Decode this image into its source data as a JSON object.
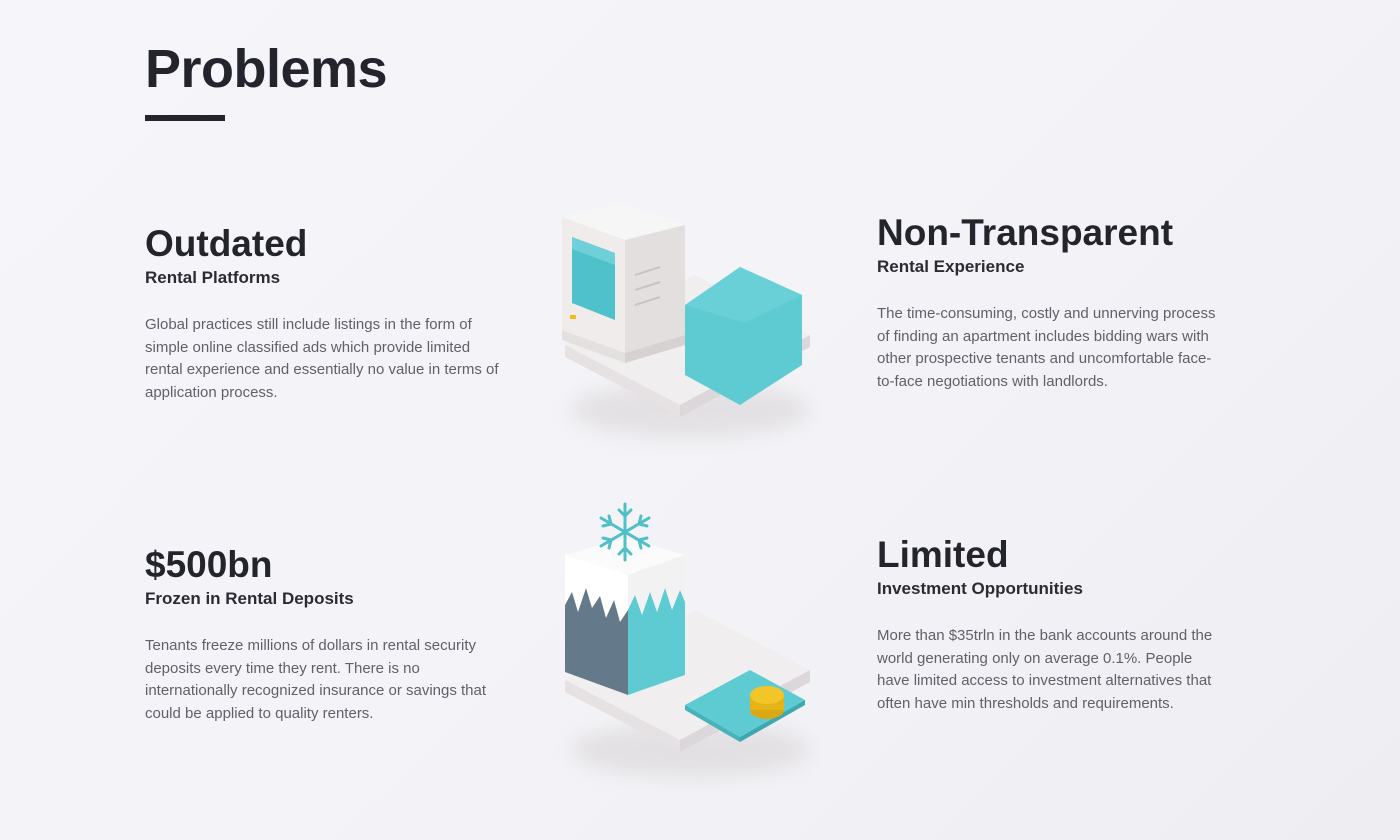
{
  "page": {
    "title": "Problems"
  },
  "problems": [
    {
      "heading": "Outdated",
      "subheading": "Rental Platforms",
      "body": "Global practices still include listings in the form of simple online classified ads which provide limited rental experience and essentially no value in terms of application process."
    },
    {
      "heading": "Non-Transparent",
      "subheading": "Rental Experience",
      "body": "The time-consuming, costly and unnerving process of finding an apartment includes bidding wars with other prospective tenants and uncomfortable face-to-face negotiations with landlords."
    },
    {
      "heading": "$500bn",
      "subheading": "Frozen in Rental Deposits",
      "body": "Tenants freeze millions of dollars in rental security deposits every time they rent. There is no internationally recognized insurance or savings that could be applied to quality renters."
    },
    {
      "heading": "Limited",
      "subheading": "Investment Opportunities",
      "body": "More than $35trln in the bank accounts around the world generating only on average 0.1%. People have limited access to investment alternatives that often have min thresholds and requirements."
    }
  ],
  "illustrations": {
    "top": "computer-and-hexagon-illustration",
    "bottom": "frozen-block-and-coin-illustration"
  },
  "colors": {
    "heading": "#24242c",
    "body_text": "#60606a",
    "accent_teal": "#5ecbd2",
    "accent_slate": "#647a8a",
    "coin_yellow": "#eebd1c"
  }
}
